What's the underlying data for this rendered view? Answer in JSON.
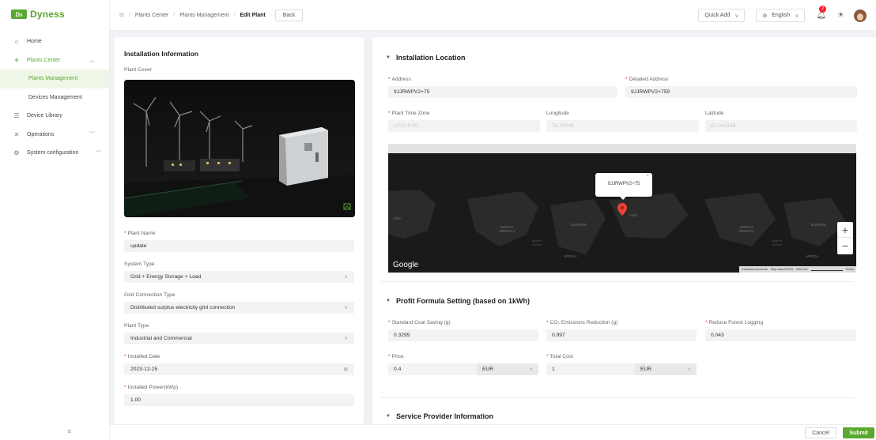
{
  "brand": {
    "name": "Dyness",
    "color": "#5aa82f"
  },
  "sidebar": {
    "items": [
      {
        "label": "Home",
        "icon": "home-icon"
      },
      {
        "label": "Plants Center",
        "icon": "plant-icon",
        "expanded": true
      },
      {
        "label": "Plants Management",
        "active": true
      },
      {
        "label": "Devices Management"
      },
      {
        "label": "Device Library",
        "icon": "database-icon"
      },
      {
        "label": "Operations",
        "icon": "tools-icon"
      },
      {
        "label": "System configuration",
        "icon": "gear-icon"
      }
    ]
  },
  "header": {
    "breadcrumb": [
      "Plants Center",
      "Plants Management",
      "Edit Plant"
    ],
    "back_label": "Back",
    "quick_add": "Quick Add",
    "language": "English",
    "notification_count": "2"
  },
  "installation_info": {
    "title": "Installation Information",
    "plant_cover_label": "Plant Cover",
    "plant_name_label": "Plant Name",
    "plant_name": "update",
    "system_type_label": "System Type",
    "system_type": "Grid + Energy Storage + Load",
    "grid_connection_label": "Grid Connection Type",
    "grid_connection": "Distributed surplus electricity grid connection",
    "plant_type_label": "Plant Type",
    "plant_type": "Industrial and Commercial",
    "installed_date_label": "Installed Date",
    "installed_date": "2023-12-25",
    "installed_power_label": "Installed Power(kWp)",
    "installed_power": "1.00"
  },
  "location": {
    "title": "Installation Location",
    "address_label": "Address",
    "address": "9JJRWPV2+75",
    "detailed_address_label": "Detailed Address",
    "detailed_address": "9JJRWPV2+759",
    "timezone_label": "Plant Time Zone",
    "timezone": "UTC+5:00",
    "longitude_label": "Longitude",
    "longitude": "76.70049",
    "latitude_label": "Latitude",
    "latitude": "62.043168",
    "map_popup": "9JJRWPV2+75",
    "map_labels": [
      "ASIA",
      "NORTH AMERICA",
      "EUROPE",
      "ASIA",
      "Atlantic Ocean",
      "AFRICA",
      "NORTH AMERICA",
      "EUROPE",
      "Atlantic Ocean",
      "AFRICA"
    ],
    "map_google": "Google",
    "map_footer": [
      "Keyboard shortcuts",
      "Map data ©2024",
      "5000 km",
      "Terms"
    ]
  },
  "profit": {
    "title": "Profit Formula Setting (based on 1kWh)",
    "coal_label": "Standard Coal Saving (g)",
    "coal": "0.3295",
    "co2_label": "CO₂ Emissions Reduction (g)",
    "co2": "0.997",
    "forest_label": "Reduce Forest Logging",
    "forest": "0.043",
    "price_label": "Price",
    "price": "0.4",
    "price_currency": "EUR",
    "total_cost_label": "Total Cost",
    "total_cost": "1",
    "total_cost_currency": "EUR"
  },
  "service": {
    "title": "Service Provider Information"
  },
  "footer": {
    "cancel": "Cancel",
    "submit": "Submit"
  }
}
